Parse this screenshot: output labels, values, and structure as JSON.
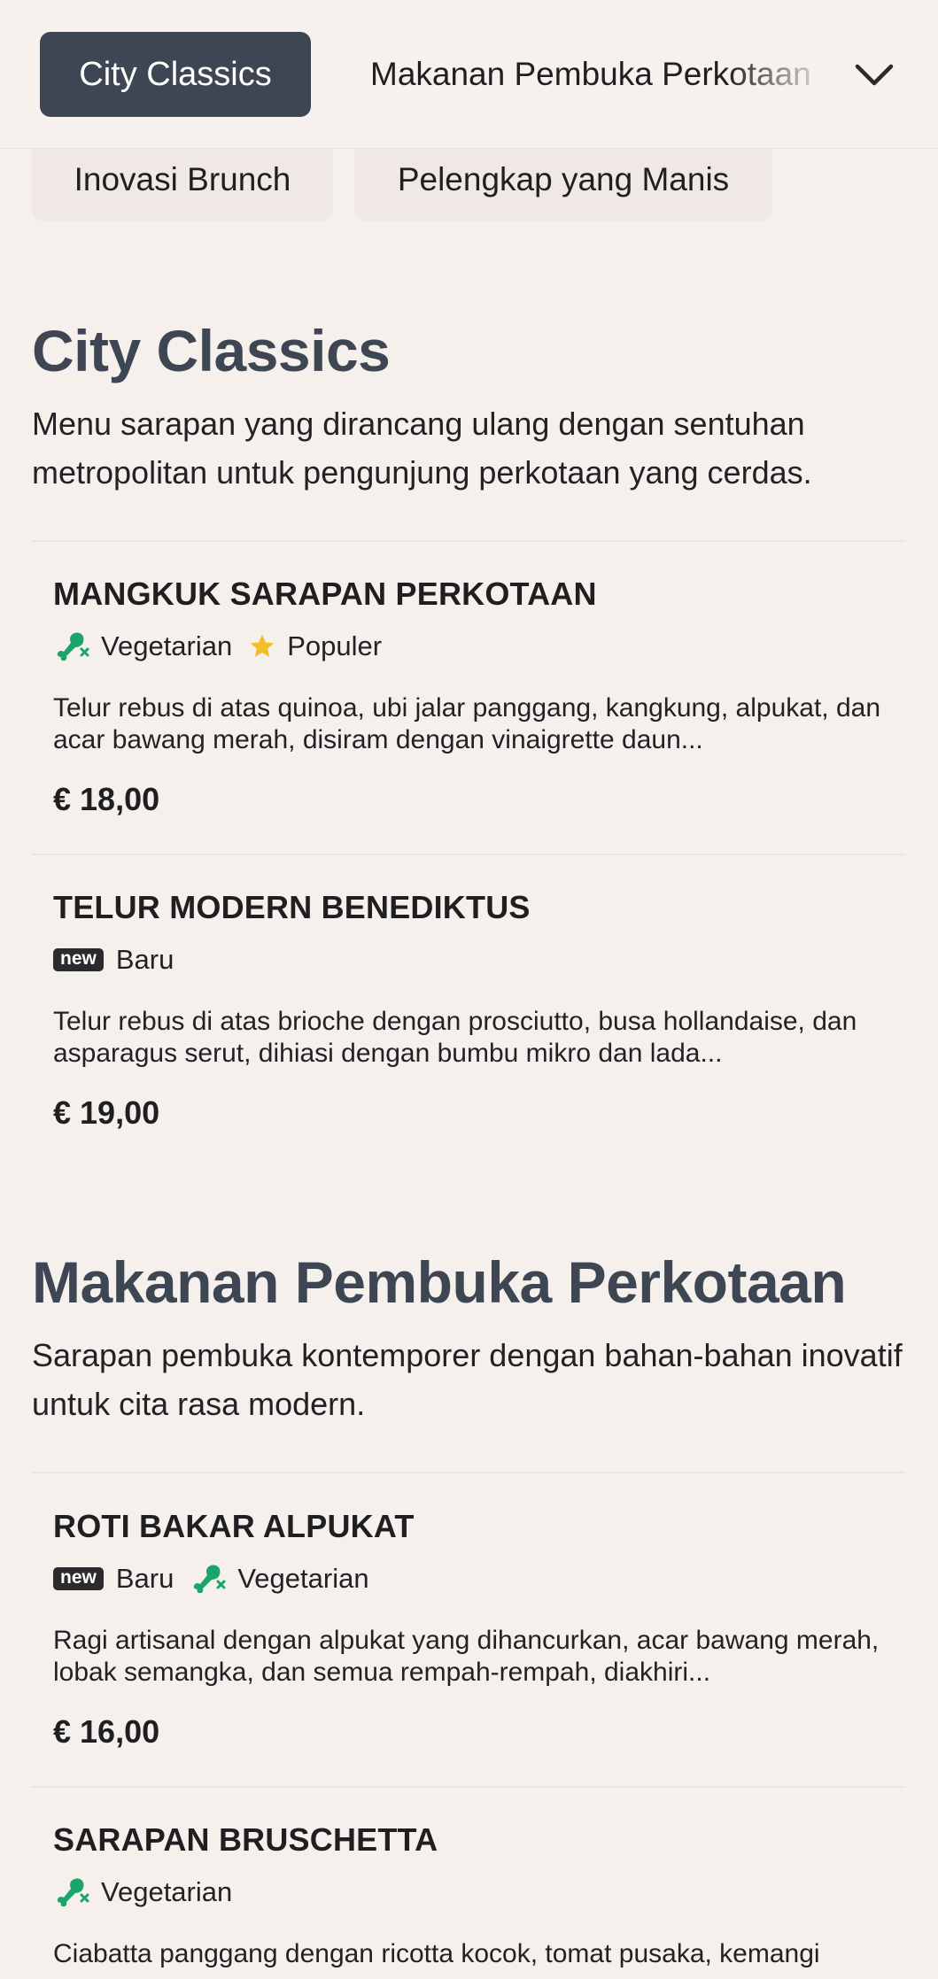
{
  "nav": {
    "active_tab": "City Classics",
    "next_tab": "Makanan Pembuka Perkotaan",
    "pills": [
      "Inovasi Brunch",
      "Pelengkap yang Manis"
    ]
  },
  "sections": [
    {
      "title": "City Classics",
      "description": "Menu sarapan yang dirancang ulang dengan sentuhan metropolitan untuk pengunjung perkotaan yang cerdas.",
      "items": [
        {
          "name": "MANGKUK SARAPAN PERKOTAAN",
          "tag1": "Vegetarian",
          "tag2": "Populer",
          "description": "Telur rebus di atas quinoa, ubi jalar panggang, kangkung, alpukat, dan acar bawang merah, disiram dengan vinaigrette daun...",
          "price": "€ 18,00"
        },
        {
          "name": "TELUR MODERN BENEDIKTUS",
          "badge": "new",
          "tag1": "Baru",
          "description": "Telur rebus di atas brioche dengan prosciutto, busa hollandaise, dan asparagus serut, dihiasi dengan bumbu mikro dan lada...",
          "price": "€ 19,00"
        }
      ]
    },
    {
      "title": "Makanan Pembuka Perkotaan",
      "description": "Sarapan pembuka kontemporer dengan bahan-bahan inovatif untuk cita rasa modern.",
      "items": [
        {
          "name": "ROTI BAKAR ALPUKAT",
          "badge": "new",
          "tag1": "Baru",
          "tag2": "Vegetarian",
          "description": "Ragi artisanal dengan alpukat yang dihancurkan, acar bawang merah, lobak semangka, dan semua rempah-rempah, diakhiri...",
          "price": "€ 16,00"
        },
        {
          "name": "SARAPAN BRUSCHETTA",
          "tag1": "Vegetarian",
          "description": "Ciabatta panggang dengan ricotta kocok, tomat pusaka, kemangi"
        }
      ]
    }
  ],
  "colors": {
    "background": "#f6f0ec",
    "active_tab": "#3d4652",
    "heading": "#3d4652",
    "vegetarian_icon": "#1aa56b",
    "star_icon": "#f5bf2a"
  },
  "icons": {
    "vegetarian": "drumstick-crossed-icon",
    "popular": "star-icon",
    "dropdown": "chevron-down-icon"
  }
}
